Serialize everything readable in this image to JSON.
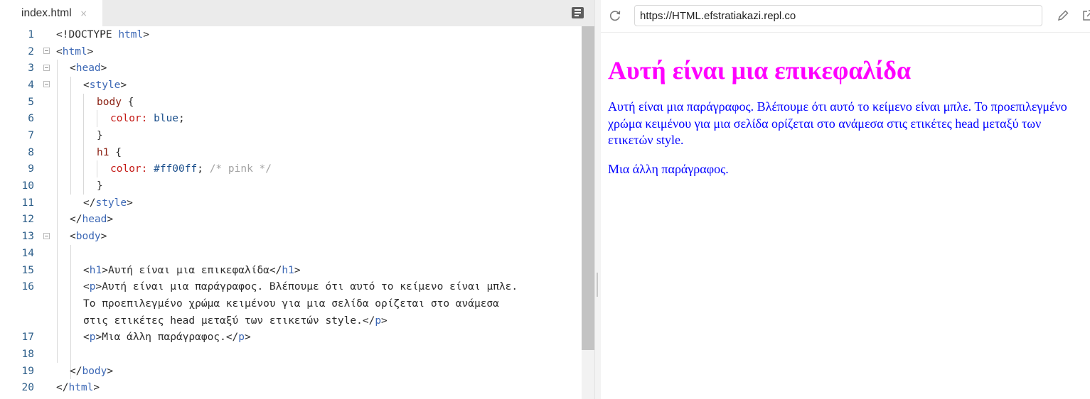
{
  "editor": {
    "tab_label": "index.html",
    "tab_close": "×",
    "line_numbers": [
      "1",
      "2",
      "3",
      "4",
      "5",
      "6",
      "7",
      "8",
      "9",
      "10",
      "11",
      "12",
      "13",
      "14",
      "15",
      "16",
      "17",
      "18",
      "19",
      "20"
    ],
    "code": {
      "l1_doctype": "<!DOCTYPE ",
      "l1_html": "html",
      "l1_close": ">",
      "open": "<",
      "close": ">",
      "open_end": "</",
      "tag_html": "html",
      "tag_head": "head",
      "tag_style": "style",
      "tag_body": "body",
      "tag_h1": "h1",
      "tag_p": "p",
      "sel_body": "body",
      "sel_h1": "h1",
      "brace_open": " {",
      "brace_close": "}",
      "prop_color": "color:",
      "val_blue": " blue",
      "val_pink": " #ff00ff",
      "semicolon": ";",
      "comment_pink": " /* pink */",
      "h1_text": "Αυτή είναι μια επικεφαλίδα",
      "p1_text_a": "Αυτή είναι μια παράγραφος. Βλέπουμε ότι αυτό το κείμενο είναι μπλε.",
      "p1_text_b": "Το προεπιλεγμένο χρώμα κειμένου για μια σελίδα ορίζεται στο ανάμεσα",
      "p1_text_c": "στις ετικέτες head μεταξύ των ετικετών style.",
      "p2_text": "Μια άλλη παράγραφος."
    }
  },
  "preview": {
    "url": "https://HTML.efstratiakazi.repl.co",
    "h1": "Αυτή είναι μια επικεφαλίδα",
    "p1": "Αυτή είναι μια παράγραφος. Βλέπουμε ότι αυτό το κείμενο είναι μπλε. Το προεπιλεγμένο χρώμα κειμένου για μια σελίδα ορίζεται στο ανάμεσα στις ετικέτες head μεταξύ των ετικετών style.",
    "p2": "Μια άλλη παράγραφος.",
    "h1_color": "#ff00ff",
    "body_color": "#0000ff"
  },
  "icons": {
    "outline": "outline-icon",
    "refresh": "refresh-icon",
    "edit": "pencil-icon",
    "open_new": "open-in-new-tab-icon"
  }
}
